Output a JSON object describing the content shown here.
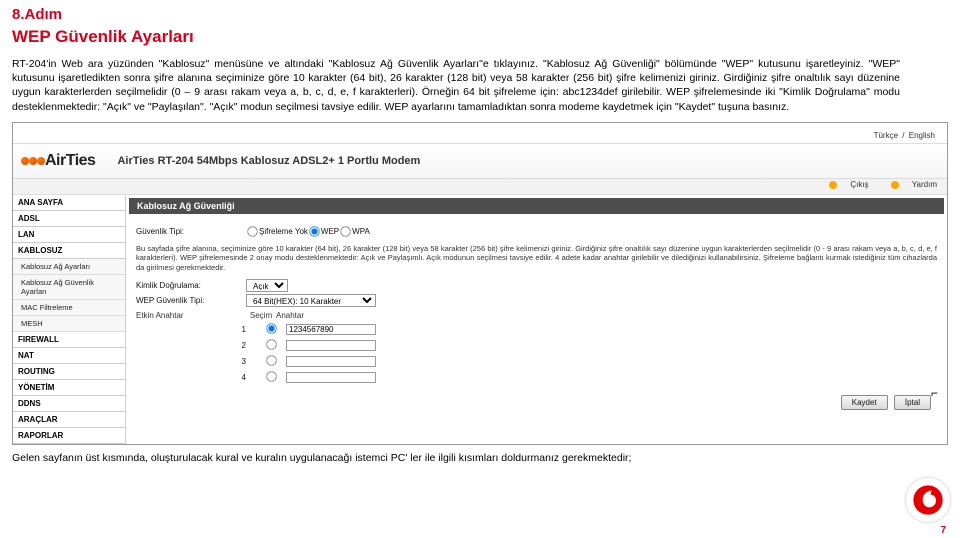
{
  "step": "8.Adım",
  "title": "WEP Güvenlik Ayarları",
  "intro": "RT-204'in Web ara yüzünden \"Kablosuz\" menüsüne ve altındaki \"Kablosuz Ağ Güvenlik Ayarları\"e tıklayınız. \"Kablosuz Ağ Güvenliği\" bölümünde \"WEP\" kutusunu işaretleyiniz. \"WEP\" kutusunu işaretledikten sonra  şifre alanına seçiminize göre 10 karakter (64 bit), 26 karakter (128 bit) veya 58 karakter (256 bit) şifre kelimenizi giriniz.  Girdiğiniz şifre onaltılık sayı düzenine uygun karakterlerden seçilmelidir (0 – 9 arası rakam veya a, b, c, d, e, f karakterleri). Örneğin 64 bit şifreleme için: abc1234def girilebilir.  WEP şifrelemesinde iki \"Kimlik Doğrulama\"  modu desteklenmektedir: \"Açık\" ve \"Paylaşılan\". \"Açık\" modun seçilmesi tavsiye edilir. WEP ayarlarını tamamladıktan sonra modeme kaydetmek için \"Kaydet\" tuşuna basınız.",
  "langbar": {
    "tr": "Türkçe",
    "sep": "/",
    "en": "English"
  },
  "brand": {
    "logo": "AirTies",
    "model": "AirTies RT-204 54Mbps Kablosuz ADSL2+ 1 Portlu Modem"
  },
  "logoutbar": {
    "exit": "Çıkış",
    "help": "Yardım"
  },
  "nav": {
    "items": [
      {
        "label": "ANA SAYFA"
      },
      {
        "label": "ADSL"
      },
      {
        "label": "LAN"
      },
      {
        "label": "KABLOSUZ",
        "subs": [
          {
            "label": "Kablosuz Ağ Ayarları"
          },
          {
            "label": "Kablosuz Ağ Güvenlik Ayarları"
          },
          {
            "label": "MAC Filtreleme"
          },
          {
            "label": "MESH"
          }
        ]
      },
      {
        "label": "FIREWALL"
      },
      {
        "label": "NAT"
      },
      {
        "label": "ROUTING"
      },
      {
        "label": "YÖNETİM"
      },
      {
        "label": "DDNS"
      },
      {
        "label": "ARAÇLAR"
      },
      {
        "label": "RAPORLAR"
      }
    ]
  },
  "content": {
    "heading": "Kablosuz Ağ Güvenliği",
    "sec_type_label": "Güvenlik Tipi:",
    "opt_none": "Şifreleme Yok",
    "opt_wep": "WEP",
    "opt_wpa": "WPA",
    "info": "Bu sayfada şifre alanına, seçiminize göre 10 karakter (64 bit), 26 karakter (128 bit) veya 58 karakter (256 bit) şifre kelimenizi giriniz. Girdiğiniz şifre onaltılık sayı düzenine uygun karakterlerden seçilmelidir (0 - 9 arası rakam veya a, b, c, d, e, f karakterleri). WEP şifrelemesinde 2 onay modu desteklenmektedir: Açık ve Paylaşımlı. Açık modunun seçilmesi tavsiye edilir. 4 adete kadar anahtar girilebilir ve dilediğinizi kullanabilirsiniz. Şifreleme bağlantı kurmak istediğiniz tüm cihazlarda da girilmesi gerekmektedir.",
    "auth_label": "Kimlik Doğrulama:",
    "auth_value": "Açık",
    "wep_type_label": "WEP Güvenlik Tipi:",
    "wep_type_value": "64 Bit(HEX): 10 Karakter",
    "active_key_label": "Etkin Anahtar",
    "col_select": "Seçim",
    "col_key": "Anahtar",
    "rows": [
      {
        "n": "1",
        "val": "1234567890"
      },
      {
        "n": "2",
        "val": ""
      },
      {
        "n": "3",
        "val": ""
      },
      {
        "n": "4",
        "val": ""
      }
    ],
    "btn_save": "Kaydet",
    "btn_cancel": "İptal"
  },
  "footer": "Gelen sayfanın üst kısmında, oluşturulacak kural ve kuralın uygulanacağı istemci PC' ler ile ilgili kısımları doldurmanız gerekmektedir;",
  "page_number": "7"
}
